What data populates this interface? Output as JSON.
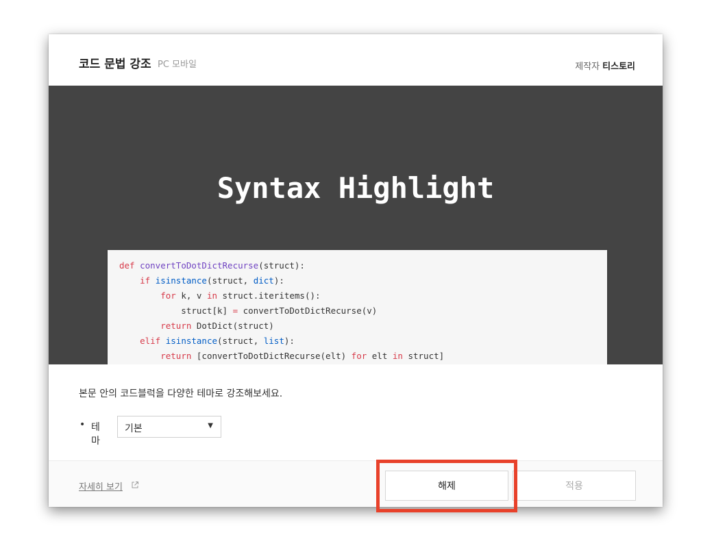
{
  "plugin": {
    "title": "코드 문법 강조",
    "platforms": "PC 모바일",
    "maker_label": "제작자",
    "maker_name": "티스토리"
  },
  "hero": {
    "title": "Syntax Highlight",
    "code_lines": [
      "def convertToDotDictRecurse(struct):",
      "    if isinstance(struct, dict):",
      "        for k, v in struct.iteritems():",
      "            struct[k] = convertToDotDictRecurse(v)",
      "        return DotDict(struct)",
      "    elif isinstance(struct, list):",
      "        return [convertToDotDictRecurse(elt) for elt in struct]"
    ]
  },
  "content": {
    "description": "본문 안의 코드블럭을 다양한 테마로 강조해보세요.",
    "theme_bullet": "•",
    "theme_label": "테마",
    "theme_value": "기본"
  },
  "footer": {
    "detail_link": "자세히 보기",
    "release_button": "해제",
    "apply_button": "적용"
  },
  "icons": {
    "external_link": "external-link-icon",
    "select_caret": "caret-down-icon"
  },
  "colors": {
    "hero_bg": "#444444",
    "highlight_border": "#e8412a"
  }
}
